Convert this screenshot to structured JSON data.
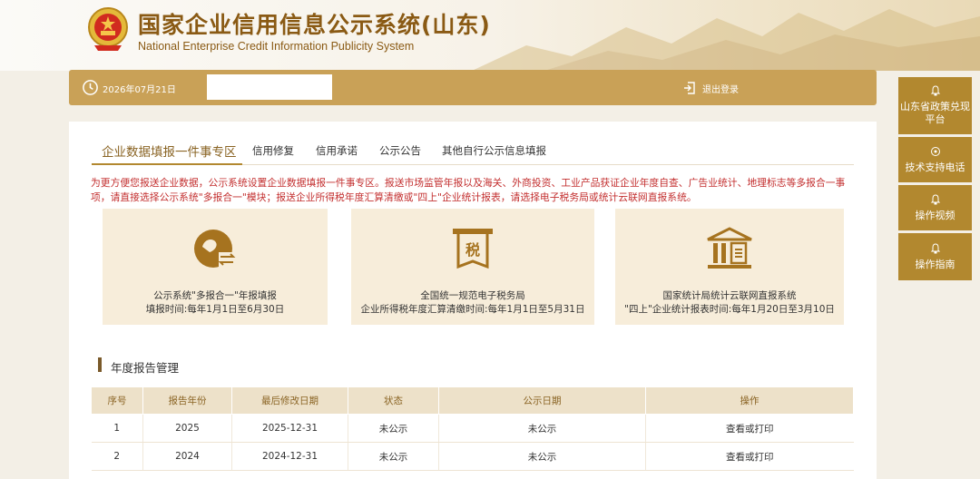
{
  "header": {
    "title": "国家企业信用信息公示系统(山东)",
    "subtitle": "National Enterprise Credit Information Publicity System"
  },
  "toolbar": {
    "date": "2026年07月21日",
    "logout_label": "退出登录"
  },
  "sidebar": {
    "items": [
      {
        "label": "山东省政策兑现平台",
        "icon": "bell-icon"
      },
      {
        "label": "技术支持电话",
        "icon": "phone-icon"
      },
      {
        "label": "操作视频",
        "icon": "bell-icon"
      },
      {
        "label": "操作指南",
        "icon": "bell-icon"
      }
    ]
  },
  "tabs": [
    {
      "label": "企业数据填报一件事专区",
      "active": true
    },
    {
      "label": "信用修复"
    },
    {
      "label": "信用承诺"
    },
    {
      "label": "公示公告"
    },
    {
      "label": "其他自行公示信息填报"
    }
  ],
  "notice": "为更方便您报送企业数据，公示系统设置企业数据填报一件事专区。报送市场监管年报以及海关、外商投资、工业产品获证企业年度自查、广告业统计、地理标志等多报合一事项，请直接选择公示系统\"多报合一\"模块；报送企业所得税年度汇算清缴或\"四上\"企业统计报表，请选择电子税务局或统计云联网直报系统。",
  "cards": [
    {
      "line1": "公示系统\"多报合一\"年报填报",
      "line2": "填报时间:每年1月1日至6月30日",
      "icon": "exchange-icon"
    },
    {
      "line1": "全国统一规范电子税务局",
      "line2": "企业所得税年度汇算清缴时间:每年1月1日至5月31日",
      "icon": "tax-icon",
      "icon_text": "税"
    },
    {
      "line1": "国家统计局统计云联网直报系统",
      "line2": "\"四上\"企业统计报表时间:每年1月20日至3月10日",
      "icon": "building-icon"
    }
  ],
  "section_title": "年度报告管理",
  "table": {
    "headers": [
      "序号",
      "报告年份",
      "最后修改日期",
      "状态",
      "公示日期",
      "操作"
    ],
    "rows": [
      [
        "1",
        "2025",
        "2025-12-31",
        "未公示",
        "未公示",
        "查看或打印"
      ],
      [
        "2",
        "2024",
        "2024-12-31",
        "未公示",
        "未公示",
        "查看或打印"
      ]
    ]
  },
  "colors": {
    "accent": "#c9a157",
    "sidebar": "#b2882f",
    "title": "#8a5a14",
    "notice": "#c32f2f",
    "card_bg": "#f7edda",
    "icon": "#a6731f"
  }
}
